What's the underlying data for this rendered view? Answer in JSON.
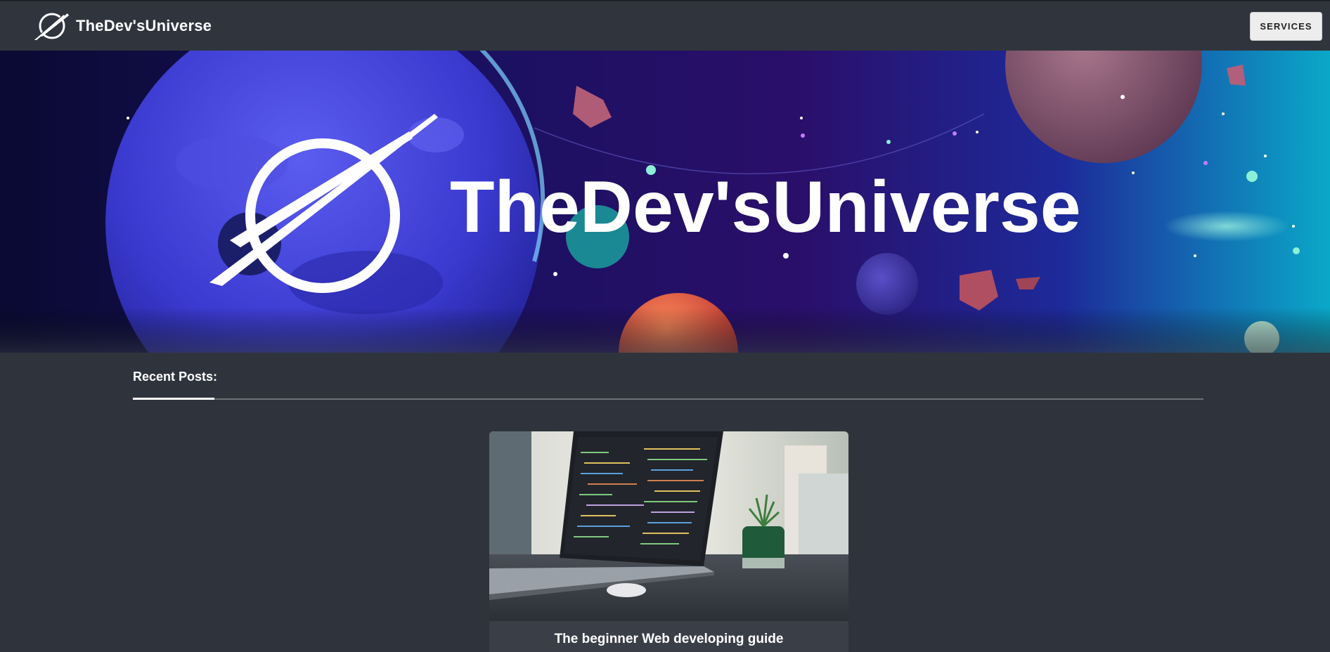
{
  "navbar": {
    "brand_name": "TheDev'sUniverse",
    "logo_icon": "orbit-slash-logo-icon",
    "services_label": "SERVICES"
  },
  "hero": {
    "title": "TheDev'sUniverse",
    "logo_icon": "orbit-slash-logo-icon",
    "background": "space-galaxy-illustration"
  },
  "recent_posts": {
    "heading": "Recent Posts:",
    "posts": [
      {
        "title": "The beginner Web developing guide",
        "image": "laptop-with-code-and-plant-photo"
      }
    ]
  },
  "colors": {
    "page_bg": "#2f343c",
    "navbar_bg": "#30353d",
    "card_bg": "#3a3f47",
    "text": "#ffffff"
  }
}
